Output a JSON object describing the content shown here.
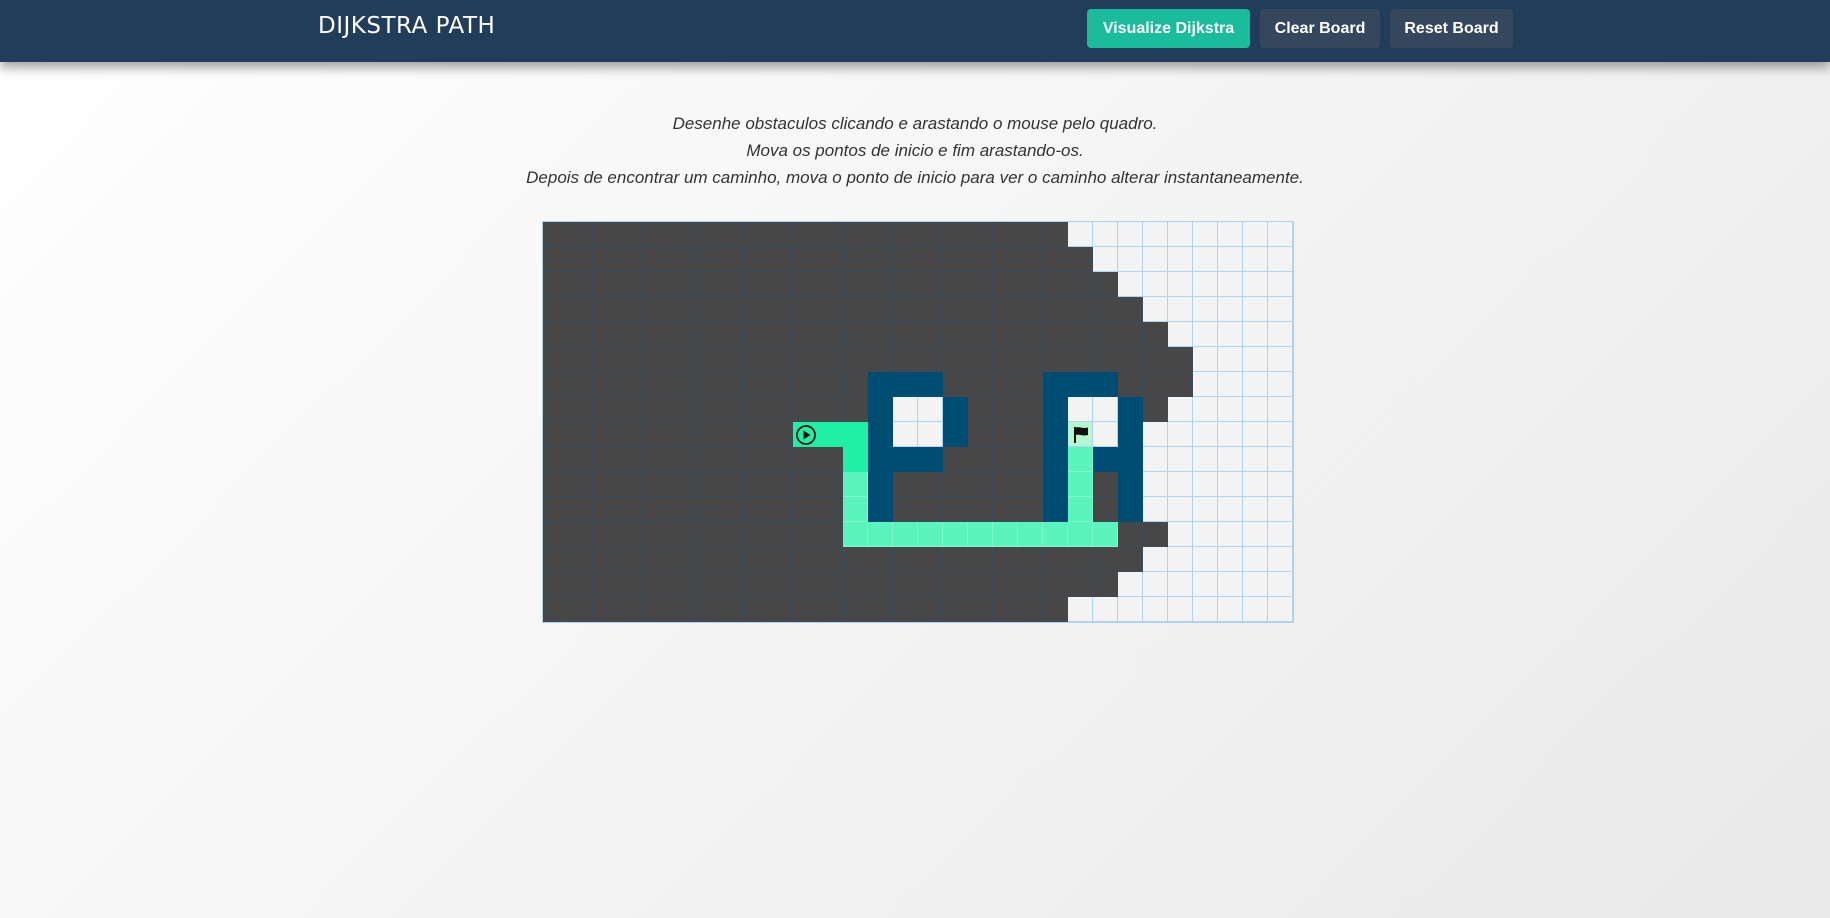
{
  "navbar": {
    "brand": "DIJKSTRA PATH",
    "buttons": {
      "visualize": "Visualize Dijkstra",
      "clear": "Clear Board",
      "reset": "Reset Board"
    }
  },
  "instructions": [
    "Desenhe obstaculos clicando e arastando o mouse pelo quadro.",
    "Mova os pontos de inicio e fim arastando-os.",
    "Depois de encontrar um caminho, mova o ponto de inicio para ver o caminho alterar instantaneamente."
  ],
  "board": {
    "rows": 16,
    "cols": 30,
    "legend": {
      ".": "unvisited",
      "v": "visited",
      "w": "wall",
      "p": "shortest-path",
      "h": "path-highlight",
      "S": "start-node",
      "T": "target-node"
    },
    "cells": [
      "vvvvvvvvvvvvvvvvvvvvv.........",
      "vvvvvvvvvvvvvvvvvvvvvv........",
      "vvvvvvvvvvvvvvvvvvvvvvv.......",
      "vvvvvvvvvvvvvvvvvvvvvvvv......",
      "vvvvvvvvvvvvvvvvvvvvvvvvv.....",
      "vvvvvvvvvvvvvvvvvvvvvvvvvv....",
      "vvvvvvvvvvvvvwwwvvvvwwwvvv....",
      "vvvvvvvvvvvvvw..wvvvw..wv.....",
      "vvvvvvvvvvShhw..wvvvwT.w......",
      "vvvvvvvvvvvvhwwwvvvvwpww......",
      "vvvvvvvvvvvvpwvvvvvvwpvw......",
      "vvvvvvvvvvvvpwvvvvvvwpvw......",
      "vvvvvvvvvvvvpppppppppppvv.....",
      "vvvvvvvvvvvvvvvvvvvvvvvv......",
      "vvvvvvvvvvvvvvvvvvvvvvv.......",
      "vvvvvvvvvvvvvvvvvvvvv........."
    ],
    "colors": {
      "unvisited": "#f3f3f3",
      "visited": "#474747",
      "wall": "#004d74",
      "path": "#5bf4bf",
      "path_highlight": "#1ff0a6",
      "grid_line": "#afd3f2"
    },
    "icons": {
      "start": "play-circle-icon",
      "target": "flag-icon"
    }
  }
}
